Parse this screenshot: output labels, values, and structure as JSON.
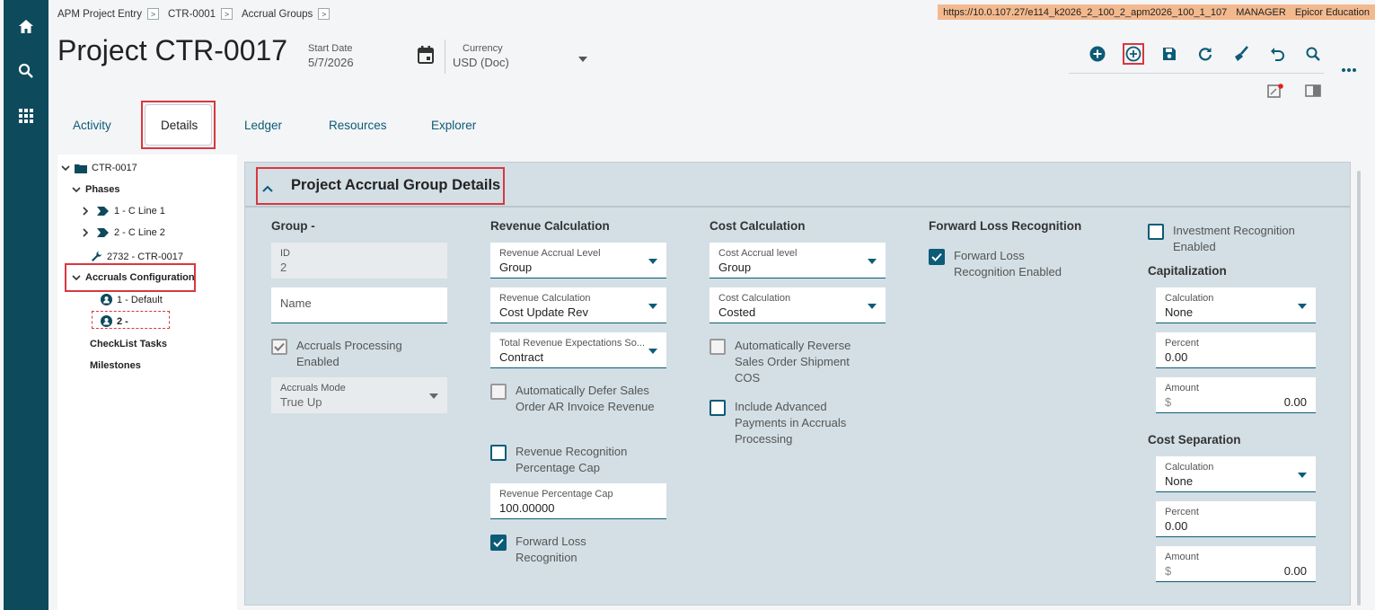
{
  "breadcrumb": {
    "items": [
      "APM Project Entry",
      "CTR-0001",
      "Accrual Groups"
    ]
  },
  "url_bar": {
    "url": "https://10.0.107.27/e114_k2026_2_100_2_apm2026_100_1_107",
    "user": "MANAGER",
    "company": "Epicor Education"
  },
  "header": {
    "title": "Project CTR-0017",
    "start_date_label": "Start Date",
    "start_date": "5/7/2026",
    "currency_label": "Currency",
    "currency": "USD (Doc)"
  },
  "tabs": [
    "Activity",
    "Details",
    "Ledger",
    "Resources",
    "Explorer"
  ],
  "tree": {
    "root": "CTR-0017",
    "phases": "Phases",
    "phase1": "1 - C Line 1",
    "phase2": "2 - C Line 2",
    "resource": "2732 - CTR-0017",
    "accruals_config": "Accruals Configuration",
    "acc1": "1 - Default",
    "acc2": "2 -",
    "checklist": "CheckList Tasks",
    "milestones": "Milestones"
  },
  "panel": {
    "title": "Project Accrual Group Details"
  },
  "group": {
    "heading": "Group -",
    "id_label": "ID",
    "id_value": "2",
    "name_label": "Name",
    "accruals_processing": "Accruals Processing Enabled",
    "accruals_mode_label": "Accruals Mode",
    "accruals_mode": "True Up"
  },
  "revenue": {
    "heading": "Revenue Calculation",
    "accrual_level_label": "Revenue Accrual Level",
    "accrual_level": "Group",
    "calc_label": "Revenue Calculation",
    "calc": "Cost Update Rev",
    "expect_label": "Total Revenue Expectations So...",
    "expect": "Contract",
    "auto_defer": "Automatically Defer Sales Order AR Invoice Revenue",
    "pct_cap": "Revenue Recognition Percentage Cap",
    "pct_cap_label": "Revenue Percentage Cap",
    "pct_cap_value": "100.00000",
    "fwd_loss": "Forward Loss Recognition"
  },
  "cost": {
    "heading": "Cost Calculation",
    "accrual_level_label": "Cost Accrual level",
    "accrual_level": "Group",
    "calc_label": "Cost Calculation",
    "calc": "Costed",
    "auto_reverse": "Automatically Reverse Sales Order Shipment COS",
    "include_adv": "Include Advanced Payments in Accruals Processing"
  },
  "forward_loss": {
    "heading": "Forward Loss Recognition",
    "enabled": "Forward Loss Recognition Enabled"
  },
  "investment": {
    "enabled": "Investment Recognition Enabled"
  },
  "capitalization": {
    "heading": "Capitalization",
    "calc_label": "Calculation",
    "calc": "None",
    "percent_label": "Percent",
    "percent": "0.00",
    "amount_label": "Amount",
    "currency": "$",
    "amount": "0.00"
  },
  "cost_separation": {
    "heading": "Cost Separation",
    "calc_label": "Calculation",
    "calc": "None",
    "percent_label": "Percent",
    "percent": "0.00",
    "amount_label": "Amount",
    "currency": "$",
    "amount": "0.00"
  },
  "colors": {
    "rail": "#0d4a5c",
    "accent": "#0c5b77",
    "highlight": "#d9373f",
    "panel": "#d3dfe5",
    "url_bar": "#f3b98e"
  }
}
